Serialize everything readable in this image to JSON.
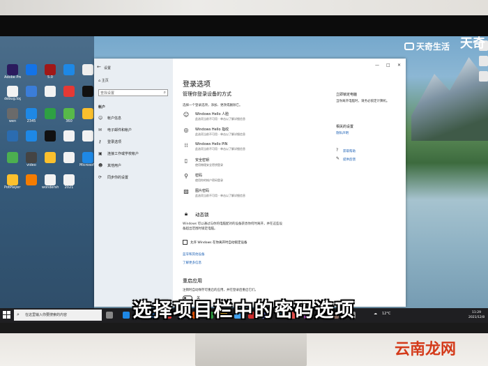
{
  "overlay": {
    "logo_text": "天奇生活",
    "logo_big": "天奇",
    "caption": "选择项目栏中的密码选项",
    "watermark": "云南龙网"
  },
  "desktop": {
    "icons": [
      {
        "label": "Adobe Premie...",
        "color": "#2b1b5e"
      },
      {
        "label": "",
        "color": "#1473e6"
      },
      {
        "label": "5.0",
        "color": "#a01818"
      },
      {
        "label": "",
        "color": "#1e88e5"
      },
      {
        "label": "",
        "color": "#eeeeee"
      },
      {
        "label": "debug.log",
        "color": "#f2f2f2"
      },
      {
        "label": "",
        "color": "#3b7dd8"
      },
      {
        "label": "",
        "color": "#f2f2f2"
      },
      {
        "label": "",
        "color": "#e53935"
      },
      {
        "label": "",
        "color": "#111111"
      },
      {
        "label": "wen",
        "color": "#6a6a6a"
      },
      {
        "label": "2345",
        "color": "#1e88e5"
      },
      {
        "label": "",
        "color": "#2ea043"
      },
      {
        "label": "360",
        "color": "#58b949"
      },
      {
        "label": "",
        "color": "#fbc02d"
      },
      {
        "label": "",
        "color": "#2b6cb0"
      },
      {
        "label": "",
        "color": "#1e88e5"
      },
      {
        "label": "",
        "color": "#111111"
      },
      {
        "label": "",
        "color": "#f2f2f2"
      },
      {
        "label": "",
        "color": "#f2f2f2"
      },
      {
        "label": "",
        "color": "#4caf50"
      },
      {
        "label": "video",
        "color": "#444"
      },
      {
        "label": "",
        "color": "#fbc02d"
      },
      {
        "label": "",
        "color": "#f2f2f2"
      },
      {
        "label": "Microsoft Edge",
        "color": "#1e88e5"
      },
      {
        "label": "PotPlayer 64",
        "color": "#fbc02d"
      },
      {
        "label": "",
        "color": "#f57c00"
      },
      {
        "label": "wondershare",
        "color": "#f2f2f2"
      },
      {
        "label": "2021",
        "color": "#f2f2f2"
      }
    ]
  },
  "settings": {
    "window_title": "设置",
    "home": "主页",
    "search_placeholder": "查找设置",
    "section": "帐户",
    "nav": [
      "帐户信息",
      "电子邮件和帐户",
      "登录选项",
      "连接工作或学校帐户",
      "其他用户",
      "同步你的设置"
    ],
    "page_title": "登录选项",
    "subtitle": "管理你登录设备的方式",
    "intro": "选择一个登录选项，添加、更改或删除它。",
    "options": [
      {
        "title": "Windows Hello 人脸",
        "desc": "此选项当前不可用 - 单击以了解详细信息"
      },
      {
        "title": "Windows Hello 指纹",
        "desc": "此选项当前不可用 - 单击以了解详细信息"
      },
      {
        "title": "Windows Hello PIN",
        "desc": "此选项当前不可用 - 单击以了解详细信息"
      },
      {
        "title": "安全密钥",
        "desc": "使用物理安全密钥登录"
      },
      {
        "title": "密码",
        "desc": "使用你的帐户密码登录"
      },
      {
        "title": "图片密码",
        "desc": "此选项当前不可用 - 单击以了解详细信息"
      }
    ],
    "dynamic_lock": "动态锁",
    "dynamic_desc1": "Windows 可以通过与你的电脑配对的设备获悉你何时离开，并在这些设",
    "dynamic_desc2": "备超出范围时锁定电脑。",
    "dynamic_checkbox": "允许 Windows 在你离开时自动锁定设备",
    "link1": "蓝牙和其他设备",
    "link2": "了解更多信息",
    "restart_title": "重启应用",
    "restart_desc": "注销时自动保存可重启的应用，并在登录后重启它们。",
    "toggle_label": "关",
    "side_title1": "立即锁定电脑",
    "side_desc1": "当你离开电脑时，请务必锁定计算机。",
    "side_title2": "相关的设置",
    "side_link1": "隐私声明",
    "side_help": "获取帮助",
    "side_feedback": "提供反馈"
  },
  "taskbar": {
    "search_text": "在这里输入你要搜索的内容",
    "weather": "12°C",
    "time": "11:29",
    "date": "2021/12/8"
  }
}
